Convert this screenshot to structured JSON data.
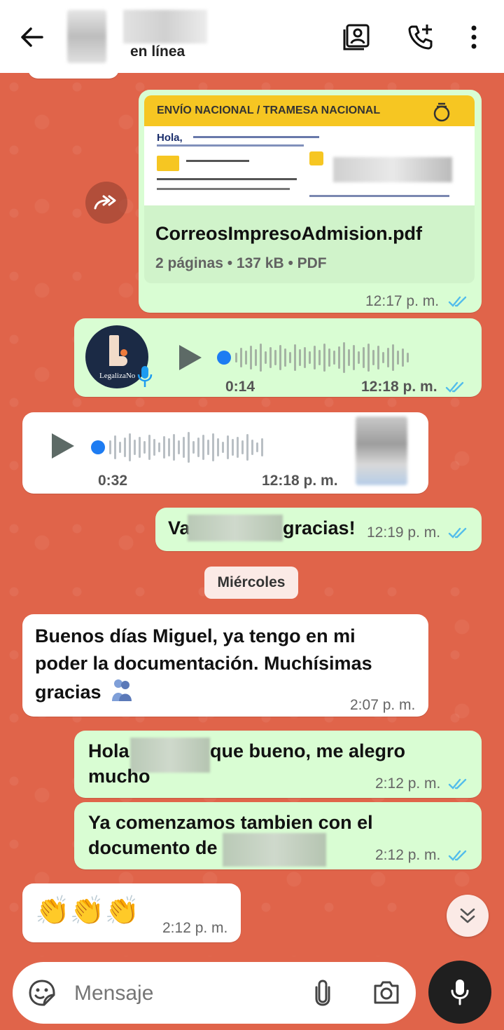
{
  "header": {
    "status": "en línea",
    "icons": [
      "back-arrow-icon",
      "contact-card-icon",
      "add-call-icon",
      "more-vert-icon"
    ]
  },
  "messages": {
    "doc": {
      "preview_banner": "ENVÍO NACIONAL / TRAMESA NACIONAL",
      "preview_greeting": "Hola,",
      "file_name": "CorreosImpresoAdmision.pdf",
      "file_meta": "2 páginas • 137 kB • PDF",
      "time": "12:17 p. m."
    },
    "audio_out": {
      "avatar_text": "LegalizaNo",
      "duration": "0:14",
      "time": "12:18 p. m."
    },
    "audio_in": {
      "duration": "0:32",
      "time": "12:18 p. m."
    },
    "msg_thanks": {
      "text_start": "Va",
      "text_end": "gracias!",
      "time": "12:19 p. m."
    },
    "date_chip": "Miércoles",
    "msg_buenos": {
      "text": "Buenos días Miguel, ya tengo en mi poder la documentación. Muchísimas gracias",
      "time": "2:07 p. m."
    },
    "msg_hola": {
      "text_start": "Hola",
      "text_end": "que bueno, me alegro",
      "text_line2": "mucho",
      "time": "2:12 p. m."
    },
    "msg_ya": {
      "text_line1": "Ya comenzamos tambien con el",
      "text_line2": "documento de",
      "time": "2:12 p. m."
    },
    "msg_claps": {
      "emoji": "👏👏👏",
      "time": "2:12 p. m."
    }
  },
  "composer": {
    "placeholder": "Mensaje",
    "icons": [
      "sticker-icon",
      "attach-icon",
      "camera-icon",
      "mic-icon"
    ]
  },
  "colors": {
    "chat_bg": "#e0644a",
    "outgoing": "#d9fdd3",
    "incoming": "#ffffff",
    "tick_blue": "#53bdeb",
    "accent_dark": "#1f1f1f"
  }
}
